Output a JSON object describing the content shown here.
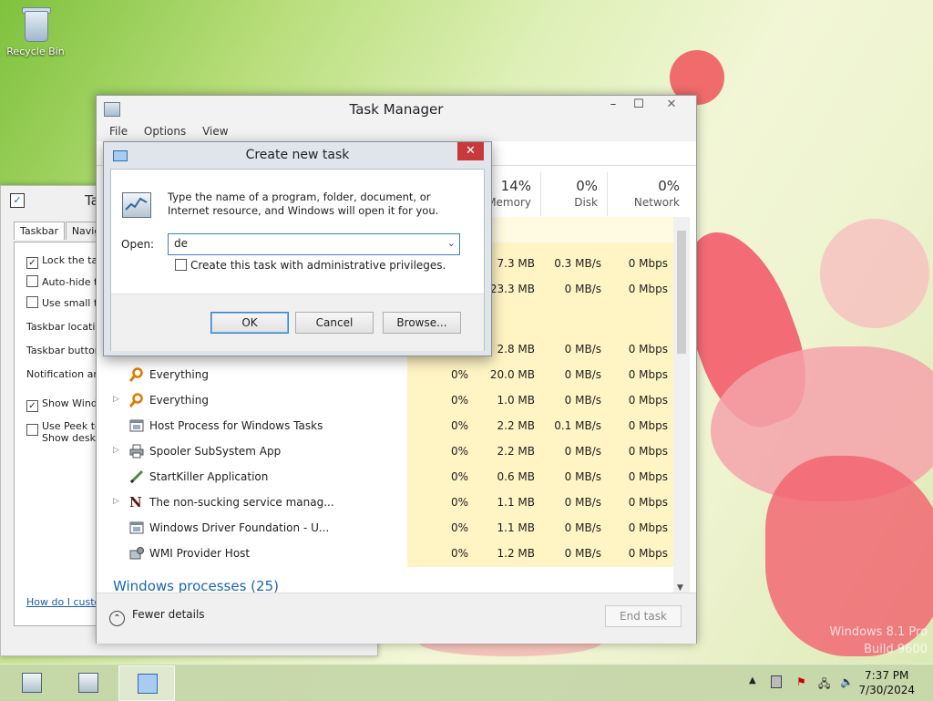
{
  "desktop": {
    "recycle_bin_label": "Recycle Bin",
    "watermark": [
      "Windows 8.1 Pro",
      "Build 9600"
    ]
  },
  "taskbar_props": {
    "title": "Ta",
    "tabs": [
      "Taskbar",
      "Naviga"
    ],
    "options": [
      {
        "label": "Lock the task",
        "checked": true
      },
      {
        "label": "Auto-hide th",
        "checked": false
      },
      {
        "label": "Use small tas",
        "checked": false
      }
    ],
    "labels": [
      "Taskbar location",
      "Taskbar buttons",
      "Notification area"
    ],
    "show_windows": {
      "label": "Show Windo",
      "checked": true
    },
    "use_peek": {
      "label_lines": [
        "Use Peek to",
        "Show deskto"
      ],
      "checked": false
    },
    "link": "How do I custom"
  },
  "task_manager": {
    "title": "Task Manager",
    "menu": [
      "File",
      "Options",
      "View"
    ],
    "columns": [
      {
        "pct": "14%",
        "label": "Memory"
      },
      {
        "pct": "0%",
        "label": "Disk"
      },
      {
        "pct": "0%",
        "label": "Network"
      }
    ],
    "top_rows": [
      {
        "memory": "7.3 MB",
        "disk": "0.3 MB/s",
        "network": "0 Mbps"
      },
      {
        "memory": "23.3 MB",
        "disk": "0 MB/s",
        "network": "0 Mbps"
      },
      {
        "memory": "",
        "disk": "",
        "network": ""
      },
      {
        "memory": "2.8 MB",
        "disk": "0 MB/s",
        "network": "0 Mbps"
      }
    ],
    "processes": [
      {
        "name": "Everything",
        "expandable": false,
        "icon": "magnifier-icon",
        "cpu": "0%",
        "memory": "20.0 MB",
        "disk": "0 MB/s",
        "network": "0 Mbps"
      },
      {
        "name": "Everything",
        "expandable": true,
        "icon": "magnifier-icon",
        "cpu": "0%",
        "memory": "1.0 MB",
        "disk": "0 MB/s",
        "network": "0 Mbps"
      },
      {
        "name": "Host Process for Windows Tasks",
        "expandable": false,
        "icon": "window-process-icon",
        "cpu": "0%",
        "memory": "2.2 MB",
        "disk": "0.1 MB/s",
        "network": "0 Mbps"
      },
      {
        "name": "Spooler SubSystem App",
        "expandable": true,
        "icon": "printer-icon",
        "cpu": "0%",
        "memory": "2.2 MB",
        "disk": "0 MB/s",
        "network": "0 Mbps"
      },
      {
        "name": "StartKiller Application",
        "expandable": false,
        "icon": "pen-icon",
        "cpu": "0%",
        "memory": "0.6 MB",
        "disk": "0 MB/s",
        "network": "0 Mbps"
      },
      {
        "name": "The non-sucking service manag...",
        "expandable": true,
        "icon": "n-letter-icon",
        "cpu": "0%",
        "memory": "1.1 MB",
        "disk": "0 MB/s",
        "network": "0 Mbps"
      },
      {
        "name": "Windows Driver Foundation - U...",
        "expandable": false,
        "icon": "window-process-icon",
        "cpu": "0%",
        "memory": "1.1 MB",
        "disk": "0 MB/s",
        "network": "0 Mbps"
      },
      {
        "name": "WMI Provider Host",
        "expandable": false,
        "icon": "gears-icon",
        "cpu": "0%",
        "memory": "1.2 MB",
        "disk": "0 MB/s",
        "network": "0 Mbps"
      }
    ],
    "section_header": "Windows processes (25)",
    "fewer_details": "Fewer details",
    "end_task": "End task"
  },
  "dialog": {
    "title": "Create new task",
    "close_glyph": "✕",
    "message": "Type the name of a program, folder, document, or Internet resource, and Windows will open it for you.",
    "open_label": "Open:",
    "open_value": "de",
    "admin_label": "Create this task with administrative privileges.",
    "admin_checked": false,
    "ok": "OK",
    "cancel": "Cancel",
    "browse": "Browse..."
  },
  "taskbar": {
    "time": "7:37 PM",
    "date": "7/30/2024"
  }
}
